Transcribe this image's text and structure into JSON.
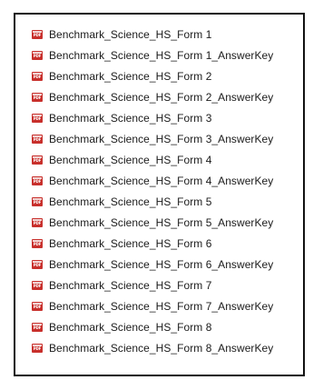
{
  "file_list": {
    "icon": "pdf-file-icon",
    "accent_color": "#c8302c",
    "items": [
      "Benchmark_Science_HS_Form 1",
      "Benchmark_Science_HS_Form 1_AnswerKey",
      "Benchmark_Science_HS_Form 2",
      "Benchmark_Science_HS_Form 2_AnswerKey",
      "Benchmark_Science_HS_Form 3",
      "Benchmark_Science_HS_Form 3_AnswerKey",
      "Benchmark_Science_HS_Form 4",
      "Benchmark_Science_HS_Form 4_AnswerKey",
      "Benchmark_Science_HS_Form 5",
      "Benchmark_Science_HS_Form 5_AnswerKey",
      "Benchmark_Science_HS_Form 6",
      "Benchmark_Science_HS_Form 6_AnswerKey",
      "Benchmark_Science_HS_Form 7",
      "Benchmark_Science_HS_Form 7_AnswerKey",
      "Benchmark_Science_HS_Form 8",
      "Benchmark_Science_HS_Form 8_AnswerKey"
    ]
  }
}
